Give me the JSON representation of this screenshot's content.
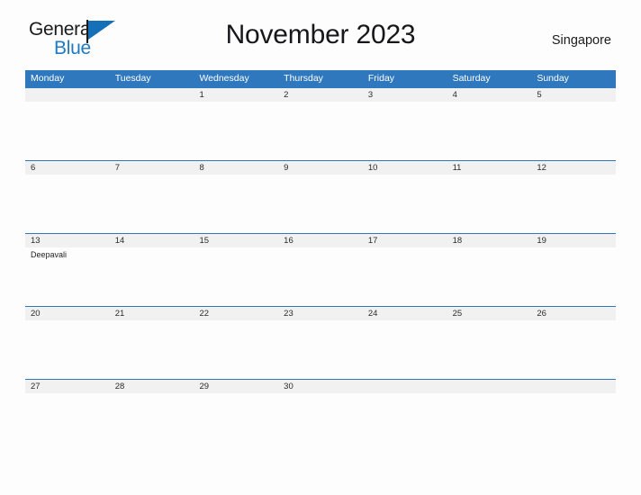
{
  "brand": {
    "name_part1": "General",
    "name_part2": "Blue",
    "flag_icon": "blue-flag-icon",
    "accent_color": "#1f7ac0"
  },
  "header": {
    "title": "November 2023",
    "locale": "Singapore"
  },
  "calendar": {
    "header_bg_color": "#2f78bd",
    "row_band_color": "#f1f1f1",
    "day_names": [
      "Monday",
      "Tuesday",
      "Wednesday",
      "Thursday",
      "Friday",
      "Saturday",
      "Sunday"
    ],
    "weeks": [
      {
        "days": [
          {
            "num": "",
            "events": []
          },
          {
            "num": "",
            "events": []
          },
          {
            "num": "1",
            "events": []
          },
          {
            "num": "2",
            "events": []
          },
          {
            "num": "3",
            "events": []
          },
          {
            "num": "4",
            "events": []
          },
          {
            "num": "5",
            "events": []
          }
        ]
      },
      {
        "days": [
          {
            "num": "6",
            "events": []
          },
          {
            "num": "7",
            "events": []
          },
          {
            "num": "8",
            "events": []
          },
          {
            "num": "9",
            "events": []
          },
          {
            "num": "10",
            "events": []
          },
          {
            "num": "11",
            "events": []
          },
          {
            "num": "12",
            "events": []
          }
        ]
      },
      {
        "days": [
          {
            "num": "13",
            "events": [
              "Deepavali"
            ]
          },
          {
            "num": "14",
            "events": []
          },
          {
            "num": "15",
            "events": []
          },
          {
            "num": "16",
            "events": []
          },
          {
            "num": "17",
            "events": []
          },
          {
            "num": "18",
            "events": []
          },
          {
            "num": "19",
            "events": []
          }
        ]
      },
      {
        "days": [
          {
            "num": "20",
            "events": []
          },
          {
            "num": "21",
            "events": []
          },
          {
            "num": "22",
            "events": []
          },
          {
            "num": "23",
            "events": []
          },
          {
            "num": "24",
            "events": []
          },
          {
            "num": "25",
            "events": []
          },
          {
            "num": "26",
            "events": []
          }
        ]
      },
      {
        "days": [
          {
            "num": "27",
            "events": []
          },
          {
            "num": "28",
            "events": []
          },
          {
            "num": "29",
            "events": []
          },
          {
            "num": "30",
            "events": []
          },
          {
            "num": "",
            "events": []
          },
          {
            "num": "",
            "events": []
          },
          {
            "num": "",
            "events": []
          }
        ]
      }
    ]
  }
}
